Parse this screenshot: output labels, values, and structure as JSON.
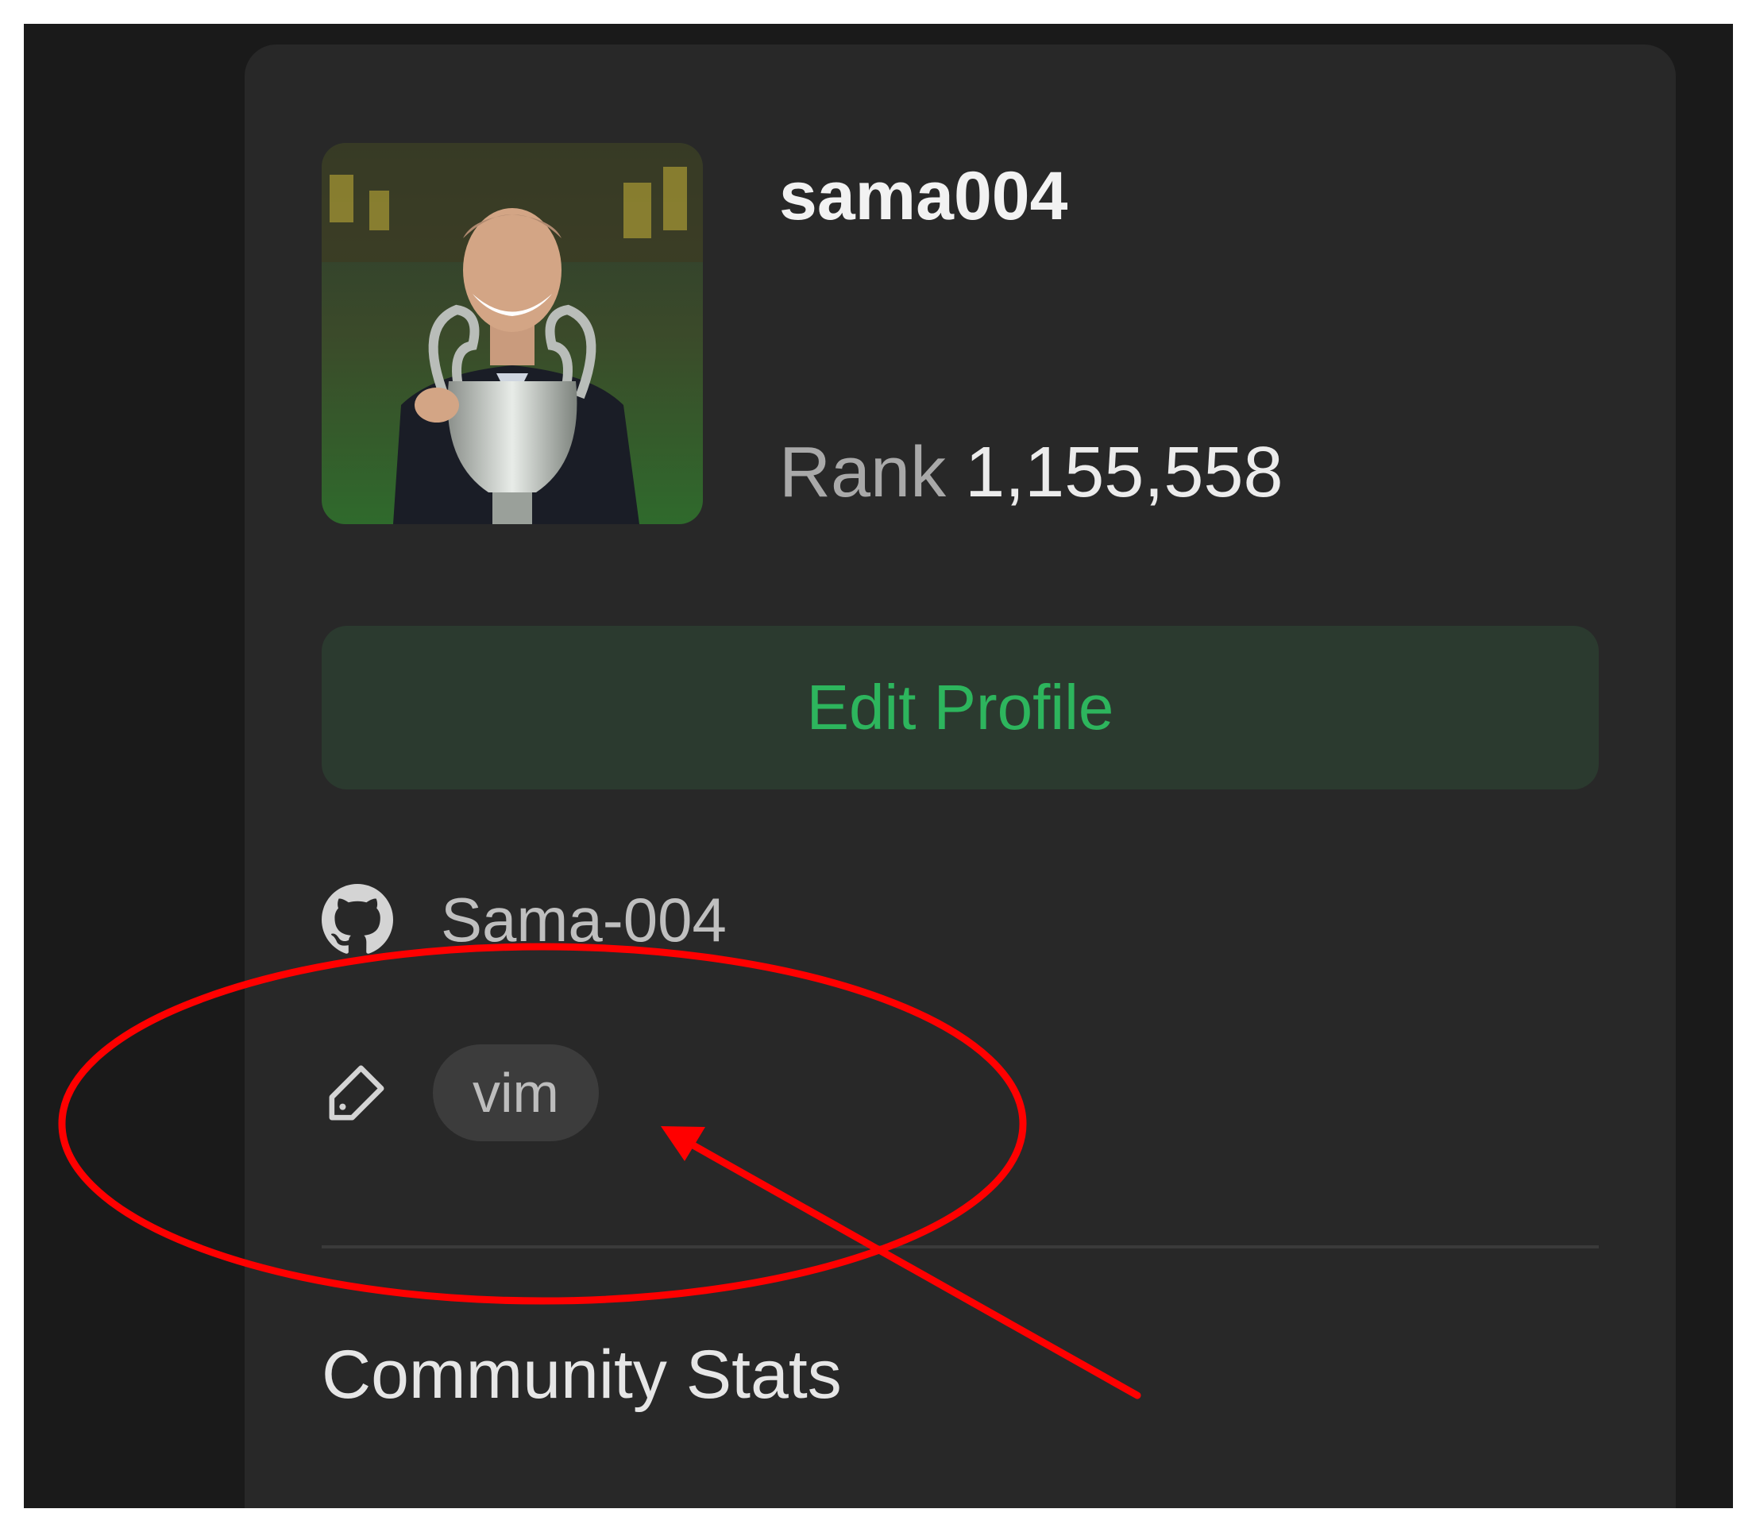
{
  "profile": {
    "username": "sama004",
    "rank_label": "Rank",
    "rank_value": "1,155,558",
    "edit_button": "Edit Profile",
    "github_username": "Sama-004",
    "skill_tag": "vim"
  },
  "section": {
    "title": "Community Stats"
  },
  "colors": {
    "page_background": "#1a1a1a",
    "card_background": "#282828",
    "accent_green": "#2db55d",
    "edit_button_background": "#2b3a2f",
    "annotation_red": "#ff0000"
  },
  "icons": {
    "github": "github-icon",
    "tag": "tag-icon"
  }
}
